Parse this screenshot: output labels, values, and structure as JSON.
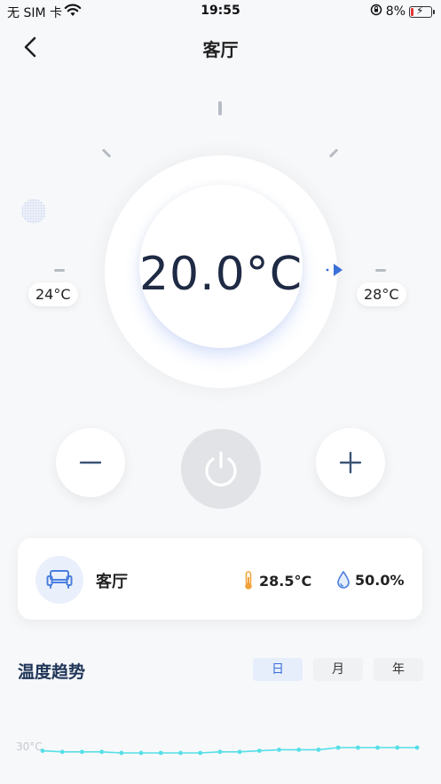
{
  "status_bar": {
    "carrier": "无 SIM 卡",
    "time": "19:55",
    "battery": "8%"
  },
  "nav": {
    "title": "客厅"
  },
  "thermostat": {
    "target_temp": "20.0°C",
    "min_label": "24°C",
    "max_label": "28°C"
  },
  "room": {
    "name": "客厅",
    "temperature": "28.5°C",
    "humidity": "50.0%"
  },
  "trend": {
    "title": "温度趋势",
    "tabs": [
      {
        "label": "日",
        "active": true
      },
      {
        "label": "月",
        "active": false
      },
      {
        "label": "年",
        "active": false
      }
    ],
    "y_label": "30°C"
  },
  "chart_data": {
    "type": "line",
    "title": "温度趋势",
    "ytick": "30°C",
    "values": [
      29.7,
      29.6,
      29.6,
      29.6,
      29.5,
      29.5,
      29.5,
      29.5,
      29.5,
      29.6,
      29.6,
      29.7,
      29.8,
      29.8,
      29.8,
      30.0,
      30.0,
      30.0,
      30.0,
      30.0
    ],
    "color": "#55dfe8"
  },
  "colors": {
    "accent": "#3b6fd9",
    "text_dark": "#1f2a44",
    "thermometer": "#f0a33a",
    "humidity": "#4a7fe0"
  }
}
